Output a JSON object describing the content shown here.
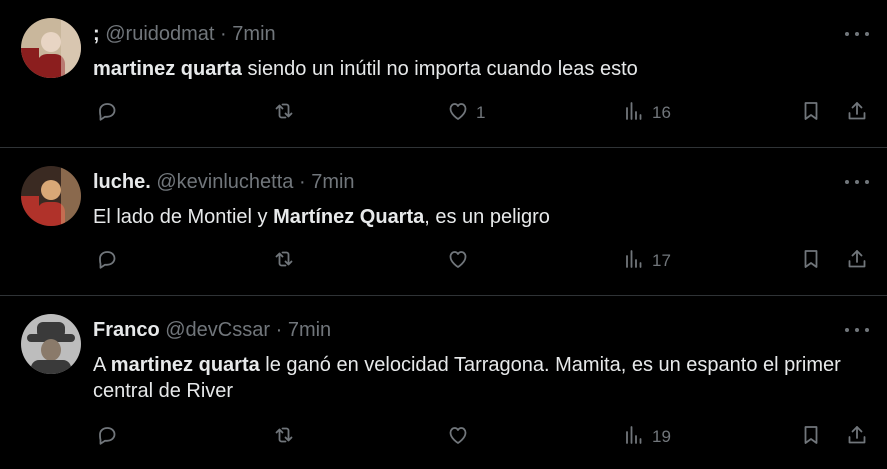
{
  "tweets": [
    {
      "name": ";",
      "handle": "@ruidodmat",
      "dot": "·",
      "time": "7min",
      "text": [
        {
          "t": "martinez quarta",
          "b": true
        },
        {
          "t": " siendo un inútil no importa cuando leas esto",
          "b": false
        }
      ],
      "likes": "1",
      "views": "16",
      "avatar_colors": [
        "#c9b79c",
        "#8b1e1e",
        "#e8d5c4"
      ]
    },
    {
      "name": "luche.",
      "handle": "@kevinluchetta",
      "dot": "·",
      "time": "7min",
      "text": [
        {
          "t": "El lado de Montiel y ",
          "b": false
        },
        {
          "t": "Martínez Quarta",
          "b": true
        },
        {
          "t": ", es un peligro",
          "b": false
        }
      ],
      "likes": "",
      "views": "17",
      "avatar_colors": [
        "#3a2a22",
        "#b0322a",
        "#d9a877"
      ]
    },
    {
      "name": "Franco",
      "handle": "@devCssar",
      "dot": "·",
      "time": "7min",
      "text": [
        {
          "t": "A ",
          "b": false
        },
        {
          "t": "martinez quarta",
          "b": true
        },
        {
          "t": " le ganó en velocidad Tarragona. Mamita, es un espanto el primer central de River",
          "b": false
        }
      ],
      "likes": "",
      "views": "19",
      "avatar_colors": [
        "#bdbdbd",
        "#3a3a3a",
        "#8a7a6a"
      ]
    }
  ],
  "icons": {
    "reply": "reply-icon",
    "retweet": "retweet-icon",
    "like": "heart-icon",
    "views": "views-icon",
    "bookmark": "bookmark-icon",
    "share": "share-icon",
    "more": "more-icon"
  }
}
